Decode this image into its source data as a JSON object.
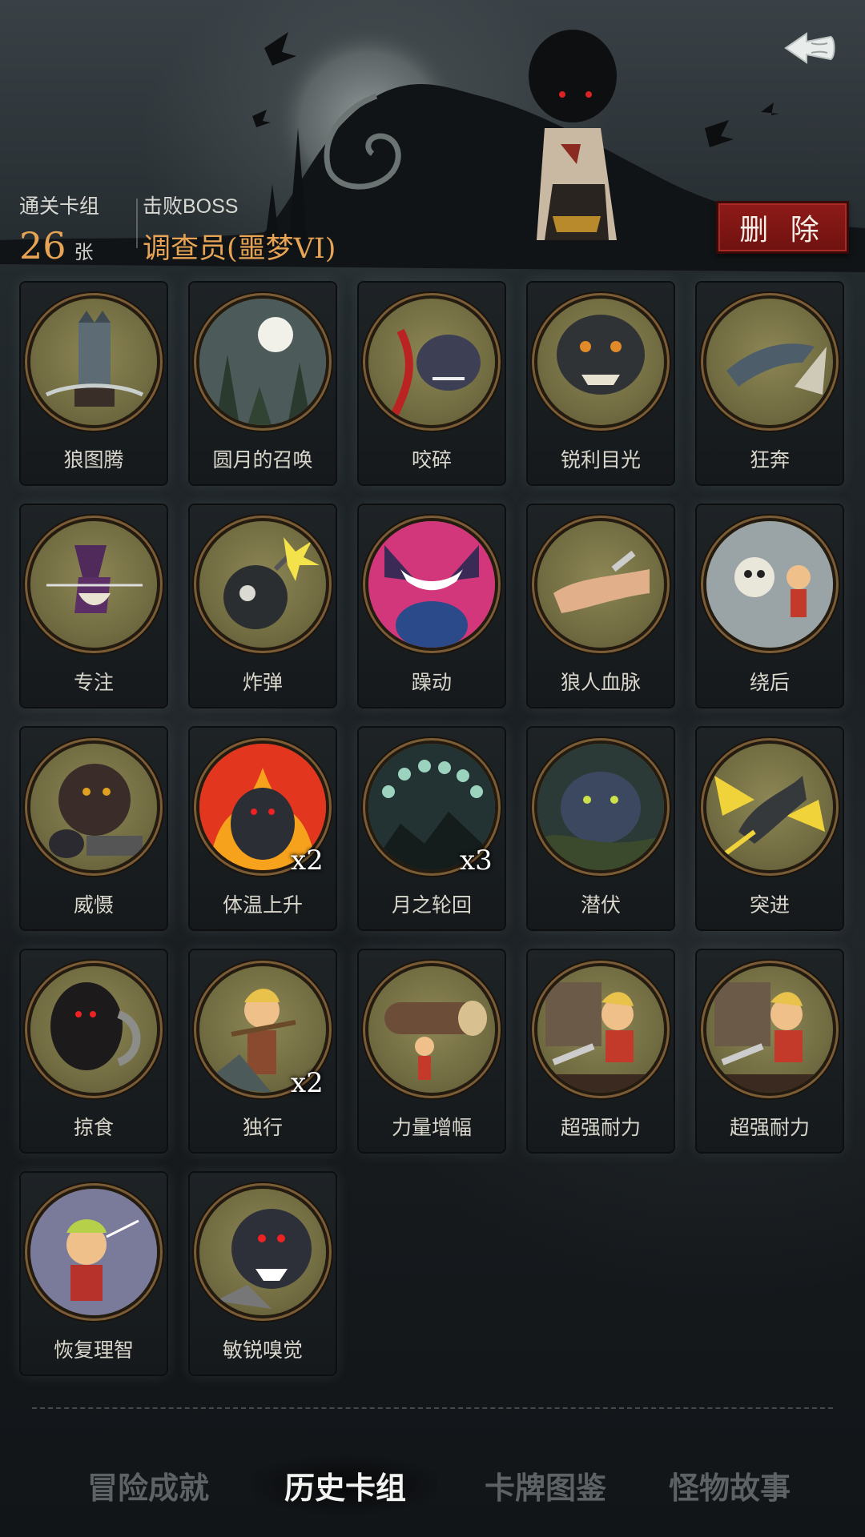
{
  "header": {
    "deck_label": "通关卡组",
    "deck_count": "26",
    "deck_unit": "张",
    "boss_label": "击败BOSS",
    "boss_name": "调查员(噩梦VI)",
    "delete_label": "删 除"
  },
  "cards": [
    {
      "name": "狼图腾",
      "art": "wolf-totem",
      "multiplier": ""
    },
    {
      "name": "圆月的召唤",
      "art": "full-moon",
      "multiplier": ""
    },
    {
      "name": "咬碎",
      "art": "bite",
      "multiplier": ""
    },
    {
      "name": "锐利目光",
      "art": "sharp-gaze",
      "multiplier": ""
    },
    {
      "name": "狂奔",
      "art": "sprint",
      "multiplier": ""
    },
    {
      "name": "专注",
      "art": "focus",
      "multiplier": ""
    },
    {
      "name": "炸弹",
      "art": "bomb",
      "multiplier": ""
    },
    {
      "name": "躁动",
      "art": "frenzy",
      "multiplier": ""
    },
    {
      "name": "狼人血脉",
      "art": "werewolf-blood",
      "multiplier": ""
    },
    {
      "name": "绕后",
      "art": "flank",
      "multiplier": ""
    },
    {
      "name": "威慑",
      "art": "intimidate",
      "multiplier": ""
    },
    {
      "name": "体温上升",
      "art": "fever",
      "multiplier": "x2"
    },
    {
      "name": "月之轮回",
      "art": "moon-cycle",
      "multiplier": "x3"
    },
    {
      "name": "潜伏",
      "art": "lurk",
      "multiplier": ""
    },
    {
      "name": "突进",
      "art": "lunge",
      "multiplier": ""
    },
    {
      "name": "掠食",
      "art": "prey",
      "multiplier": ""
    },
    {
      "name": "独行",
      "art": "lone-walk",
      "multiplier": "x2"
    },
    {
      "name": "力量增幅",
      "art": "power-up",
      "multiplier": ""
    },
    {
      "name": "超强耐力",
      "art": "endurance",
      "multiplier": ""
    },
    {
      "name": "超强耐力",
      "art": "endurance",
      "multiplier": ""
    },
    {
      "name": "恢复理智",
      "art": "restore-sanity",
      "multiplier": ""
    },
    {
      "name": "敏锐嗅觉",
      "art": "keen-smell",
      "multiplier": ""
    }
  ],
  "tabs": [
    {
      "label": "冒险成就",
      "active": false
    },
    {
      "label": "历史卡组",
      "active": true
    },
    {
      "label": "卡牌图鉴",
      "active": false
    },
    {
      "label": "怪物故事",
      "active": false
    }
  ],
  "colors": {
    "accent_gold": "#e7a455",
    "delete_red": "#8e1b18",
    "medallion_olive": "#7a7447",
    "tab_active": "#f2f2f0",
    "tab_inactive": "#5d6265"
  },
  "icons": {
    "back": "back-arrow-icon"
  }
}
